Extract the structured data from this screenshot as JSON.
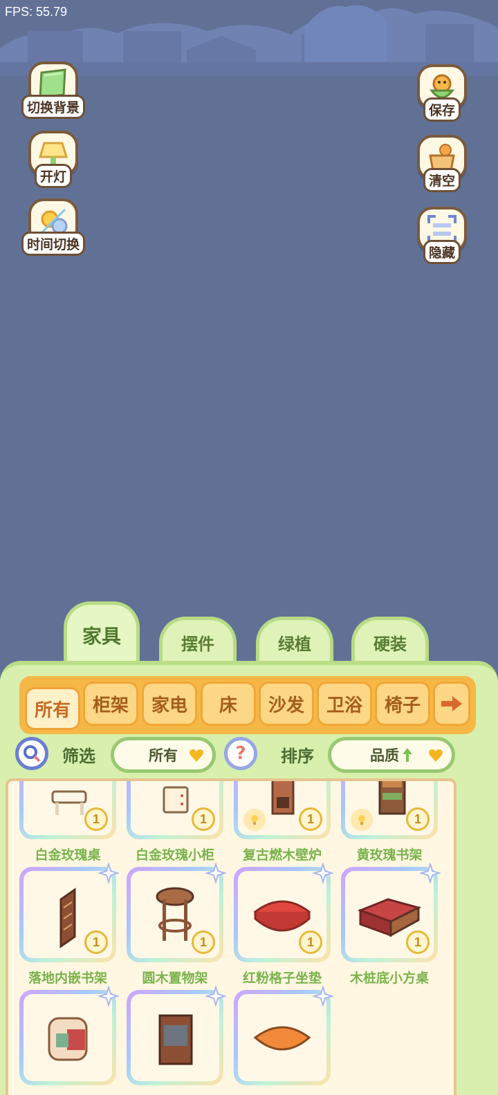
{
  "status": {
    "fps": "FPS: 55.79"
  },
  "left_buttons": [
    {
      "label": "切换背景",
      "icon": "backdrop-icon"
    },
    {
      "label": "开灯",
      "icon": "lamp-icon"
    },
    {
      "label": "时间切换",
      "icon": "sun-moon-icon"
    }
  ],
  "right_buttons": [
    {
      "label": "保存",
      "icon": "bird-save-icon"
    },
    {
      "label": "清空",
      "icon": "box-clear-icon"
    },
    {
      "label": "隐藏",
      "icon": "hide-frame-icon"
    }
  ],
  "main_tabs": [
    {
      "label": "家具",
      "active": true
    },
    {
      "label": "摆件",
      "active": false
    },
    {
      "label": "绿植",
      "active": false
    },
    {
      "label": "硬装",
      "active": false
    }
  ],
  "sub_tabs": [
    {
      "label": "所有",
      "active": true
    },
    {
      "label": "柜架"
    },
    {
      "label": "家电"
    },
    {
      "label": "床"
    },
    {
      "label": "沙发"
    },
    {
      "label": "卫浴"
    },
    {
      "label": "椅子"
    }
  ],
  "filter": {
    "filter_label": "筛选",
    "filter_value": "所有",
    "sort_label": "排序",
    "sort_value": "品质"
  },
  "items": [
    {
      "name": "白金玫瑰桌",
      "count": "1",
      "icon": "vanity-desk-icon"
    },
    {
      "name": "白金玫瑰小柜",
      "count": "1",
      "icon": "small-cabinet-icon"
    },
    {
      "name": "复古燃木壁炉",
      "count": "1",
      "icon": "fireplace-icon"
    },
    {
      "name": "黄玫瑰书架",
      "count": "1",
      "icon": "bookshelf-icon"
    },
    {
      "name": "落地内嵌书架",
      "count": "1",
      "icon": "wall-bookshelf-icon"
    },
    {
      "name": "圆木置物架",
      "count": "1",
      "icon": "round-stand-icon"
    },
    {
      "name": "红粉格子坐垫",
      "count": "1",
      "icon": "red-cushion-icon"
    },
    {
      "name": "木桩底小方桌",
      "count": "1",
      "icon": "square-table-icon"
    },
    {
      "name": "",
      "count": "",
      "icon": "armchair-icon"
    },
    {
      "name": "",
      "count": "",
      "icon": "tv-cabinet-icon"
    },
    {
      "name": "",
      "count": "",
      "icon": "orange-cushion-icon"
    }
  ],
  "colors": {
    "background": "#617196",
    "panel": "#d8efad",
    "sub_tab_bar": "#f5b846",
    "item_name": "#79b34c"
  }
}
